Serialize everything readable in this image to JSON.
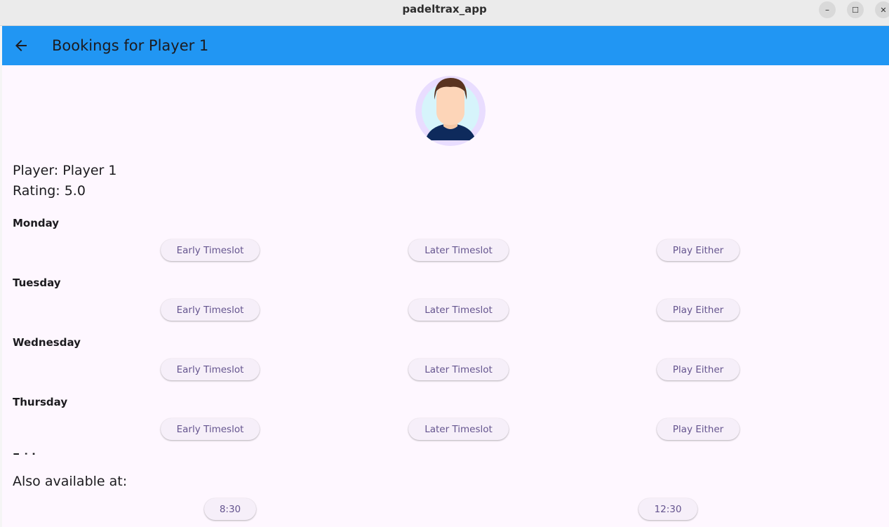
{
  "window": {
    "title": "padeltrax_app",
    "minimize_label": "–",
    "maximize_label": "☐",
    "close_label": "✕"
  },
  "appbar": {
    "title": "Bookings for Player 1"
  },
  "player": {
    "name_line": "Player: Player 1",
    "rating_line": "Rating: 5.0"
  },
  "days": [
    {
      "name": "Monday",
      "early": "Early Timeslot",
      "later": "Later Timeslot",
      "either": "Play Either"
    },
    {
      "name": "Tuesday",
      "early": "Early Timeslot",
      "later": "Later Timeslot",
      "either": "Play Either"
    },
    {
      "name": "Wednesday",
      "early": "Early Timeslot",
      "later": "Later Timeslot",
      "either": "Play Either"
    },
    {
      "name": "Thursday",
      "early": "Early Timeslot",
      "later": "Later Timeslot",
      "either": "Play Either"
    },
    {
      "name": "Friday"
    }
  ],
  "also_available": {
    "label": "Also available at:",
    "times": [
      "8:30",
      "12:30"
    ]
  },
  "colors": {
    "appbar": "#2196f3",
    "background": "#fef7ff",
    "button_text": "#65558f",
    "avatar_ring": "#e9ddff",
    "avatar_bg": "#d6f4fb",
    "shirt": "#0e2a5c",
    "hair": "#5a3320"
  },
  "icons": {
    "back": "arrow-back-icon",
    "avatar": "person-avatar"
  }
}
